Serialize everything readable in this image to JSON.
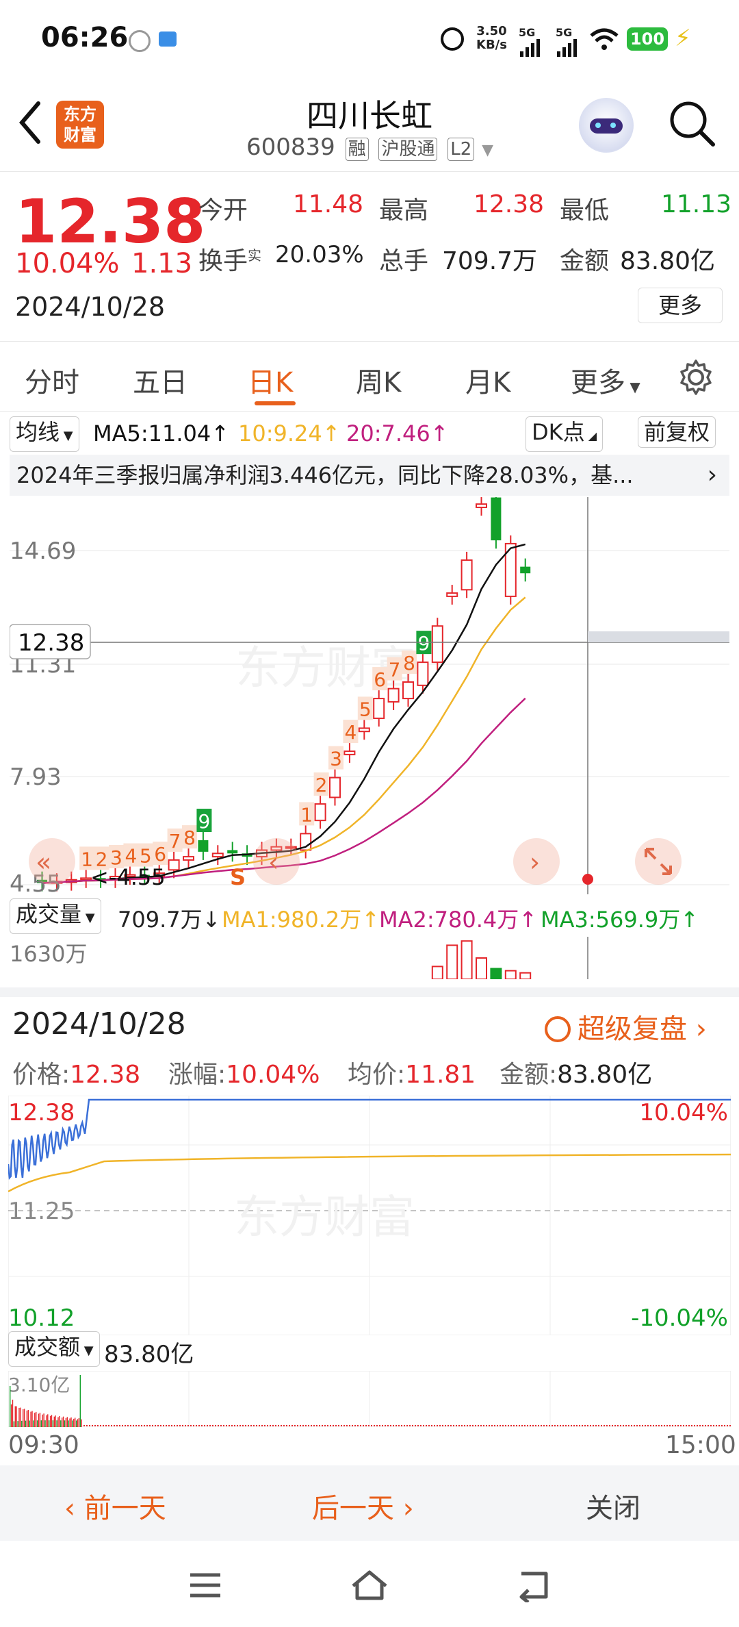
{
  "status_bar": {
    "time": "06:26",
    "net_speed_top": "3.50",
    "net_speed_bottom": "KB/s",
    "sig1": "5G",
    "sig2": "5G",
    "battery": "100"
  },
  "header": {
    "logo_line1": "东方",
    "logo_line2": "财富",
    "stock_name": "四川长虹",
    "stock_code": "600839",
    "tags": [
      "融",
      "沪股通",
      "L2"
    ]
  },
  "quote": {
    "price": "12.38",
    "change_pct": "10.04%",
    "change_amt": "1.13",
    "date": "2024/10/28",
    "open_label": "今开",
    "open": "11.48",
    "high_label": "最高",
    "high": "12.38",
    "low_label": "最低",
    "low": "11.13",
    "turnover_label": "换手",
    "turnover_sup": "实",
    "turnover": "20.03%",
    "volume_label": "总手",
    "volume": "709.7万",
    "amount_label": "金额",
    "amount": "83.80亿",
    "more": "更多"
  },
  "tabs": [
    "分时",
    "五日",
    "日K",
    "周K",
    "月K",
    "更多"
  ],
  "active_tab": "日K",
  "ma_bar": {
    "ma_label": "均线",
    "ma5": "MA5:11.04",
    "ma10": "10:9.24",
    "ma20": "20:7.46",
    "dk": "DK点",
    "adjust": "前复权"
  },
  "news": "2024年三季报归属净利润3.446亿元，同比下降28.03%，基...",
  "chart_data": {
    "type": "candlestick",
    "y_ticks": [
      "14.69",
      "11.31",
      "7.93",
      "4.55"
    ],
    "price_tag": "12.38",
    "low_marker": "<-4.55",
    "nine_turn_sequence_1": [
      "1",
      "2",
      "3",
      "4",
      "5",
      "6",
      "7",
      "8",
      "9"
    ],
    "nine_turn_sequence_2": [
      "1",
      "2",
      "3",
      "4",
      "5",
      "6",
      "7",
      "8",
      "9"
    ],
    "s_marker": "S",
    "candles": [
      {
        "o": 4.7,
        "c": 4.6
      },
      {
        "o": 4.6,
        "c": 4.65
      },
      {
        "o": 4.62,
        "c": 4.7
      },
      {
        "o": 4.7,
        "c": 4.75
      },
      {
        "o": 4.75,
        "c": 4.7
      },
      {
        "o": 4.7,
        "c": 4.8
      },
      {
        "o": 4.8,
        "c": 4.85
      },
      {
        "o": 4.85,
        "c": 4.8
      },
      {
        "o": 4.8,
        "c": 4.9
      },
      {
        "o": 5.0,
        "c": 5.3
      },
      {
        "o": 5.3,
        "c": 5.4
      },
      {
        "o": 5.9,
        "c": 5.55
      },
      {
        "o": 5.4,
        "c": 5.5
      },
      {
        "o": 5.6,
        "c": 5.5
      },
      {
        "o": 5.5,
        "c": 5.4
      },
      {
        "o": 5.4,
        "c": 5.6
      },
      {
        "o": 5.6,
        "c": 5.7
      },
      {
        "o": 5.7,
        "c": 5.7
      },
      {
        "o": 5.6,
        "c": 6.1
      },
      {
        "o": 6.5,
        "c": 7.0
      },
      {
        "o": 7.2,
        "c": 7.8
      },
      {
        "o": 8.5,
        "c": 8.6
      },
      {
        "o": 9.2,
        "c": 9.3
      },
      {
        "o": 9.6,
        "c": 10.2
      },
      {
        "o": 10.1,
        "c": 10.5
      },
      {
        "o": 10.2,
        "c": 10.7
      },
      {
        "o": 10.6,
        "c": 11.3
      },
      {
        "o": 11.3,
        "c": 12.4
      },
      {
        "o": 13.3,
        "c": 13.4
      },
      {
        "o": 13.5,
        "c": 14.4
      },
      {
        "o": 16.0,
        "c": 16.1
      },
      {
        "o": 16.3,
        "c": 15.0
      },
      {
        "o": 13.3,
        "c": 14.9
      },
      {
        "o": 14.2,
        "c": 14.0
      }
    ],
    "ma_colors": {
      "ma5": "#111111",
      "ma10": "#f0b429",
      "ma20": "#c01f7e"
    }
  },
  "volume_bar": {
    "label": "成交量",
    "value": "709.7万",
    "ma1": "MA1:980.2万",
    "ma2": "MA2:780.4万",
    "ma3": "MA3:569.9万",
    "tick": "1630万"
  },
  "replay": {
    "date": "2024/10/28",
    "title": "超级复盘",
    "price_label": "价格:",
    "price": "12.38",
    "change_label": "涨幅:",
    "change": "10.04%",
    "avg_label": "均价:",
    "avg": "11.81",
    "amount_label": "金额:",
    "amount": "83.80亿",
    "y_top": "12.38",
    "y_mid": "11.25",
    "y_bottom": "10.12",
    "pct_top": "10.04%",
    "pct_bottom": "-10.04%",
    "amt_label": "成交额",
    "amt_value": "83.80亿",
    "amt_tick": "3.10亿",
    "time_start": "09:30",
    "time_end": "15:00"
  },
  "bottom_actions": {
    "prev": "前一天",
    "next": "后一天",
    "close": "关闭"
  },
  "colors": {
    "up": "#e5262b",
    "down": "#12a12a",
    "accent": "#e8601c"
  }
}
